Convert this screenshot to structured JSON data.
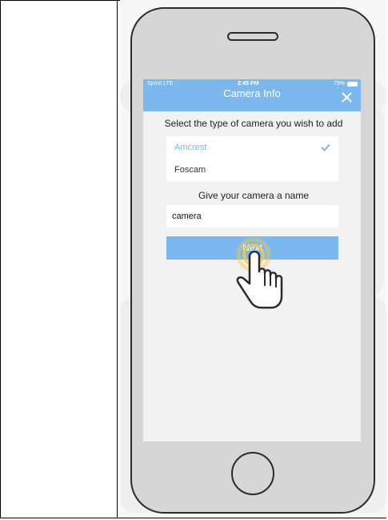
{
  "status_bar": {
    "carrier": "Sprint LTE",
    "time": "2:45 PM",
    "battery": "79%"
  },
  "nav": {
    "title": "Camera Info",
    "close_icon": "close-icon"
  },
  "camera_type": {
    "prompt": "Select the type of camera you wish to add",
    "options": [
      {
        "label": "Amcrest",
        "selected": true
      },
      {
        "label": "Foscam",
        "selected": false
      }
    ]
  },
  "camera_name": {
    "prompt": "Give your camera a name",
    "value": "camera"
  },
  "next_button": {
    "label": "Next"
  },
  "colors": {
    "accent": "#7cb8ee",
    "phone_body": "#d6d6d6",
    "tap_ring": "#f2c94c"
  }
}
